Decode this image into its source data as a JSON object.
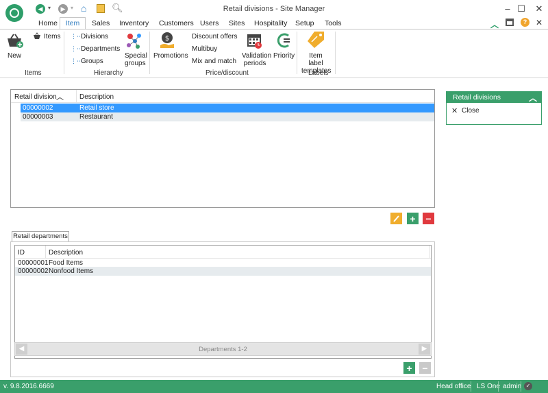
{
  "window": {
    "title": "Retail divisions - Site Manager"
  },
  "menu_tabs": [
    "Home",
    "Item",
    "Sales",
    "Inventory",
    "Customers",
    "Users",
    "Sites",
    "Hospitality",
    "Setup",
    "Tools"
  ],
  "ribbon": {
    "new": "New",
    "items": "Items",
    "group_items": "Items",
    "divisions": "Divisions",
    "departments": "Departments",
    "groups": "Groups",
    "special_groups_1": "Special",
    "special_groups_2": "groups",
    "group_hierarchy": "Hierarchy",
    "promotions": "Promotions",
    "discount_offers": "Discount offers",
    "multibuy": "Multibuy",
    "mix_and_match": "Mix and match",
    "validation_1": "Validation",
    "validation_2": "periods",
    "priority": "Priority",
    "group_price": "Price/discount",
    "item_label_1": "Item label",
    "item_label_2": "templates",
    "group_labels": "Labels"
  },
  "divisions_grid": {
    "col_division": "Retail division",
    "col_description": "Description",
    "rows": [
      {
        "id": "00000002",
        "description": "Retail store"
      },
      {
        "id": "00000003",
        "description": "Restaurant"
      }
    ]
  },
  "departments": {
    "tab": "Retail departments",
    "col_id": "ID",
    "col_description": "Description",
    "rows": [
      {
        "id": "00000001",
        "description": "Food Items"
      },
      {
        "id": "00000002",
        "description": "Nonfood Items"
      }
    ],
    "pager": "Departments 1-2"
  },
  "side_panel": {
    "title": "Retail divisions",
    "close": "Close"
  },
  "status": {
    "version": "v. 9.8.2016.6669",
    "location": "Head office",
    "product": "LS One",
    "user": "admin"
  },
  "colors": {
    "accent_green": "#3a9f6b",
    "selection_blue": "#3399ff",
    "edit_orange": "#f0ad2d",
    "delete_red": "#e0393e"
  }
}
